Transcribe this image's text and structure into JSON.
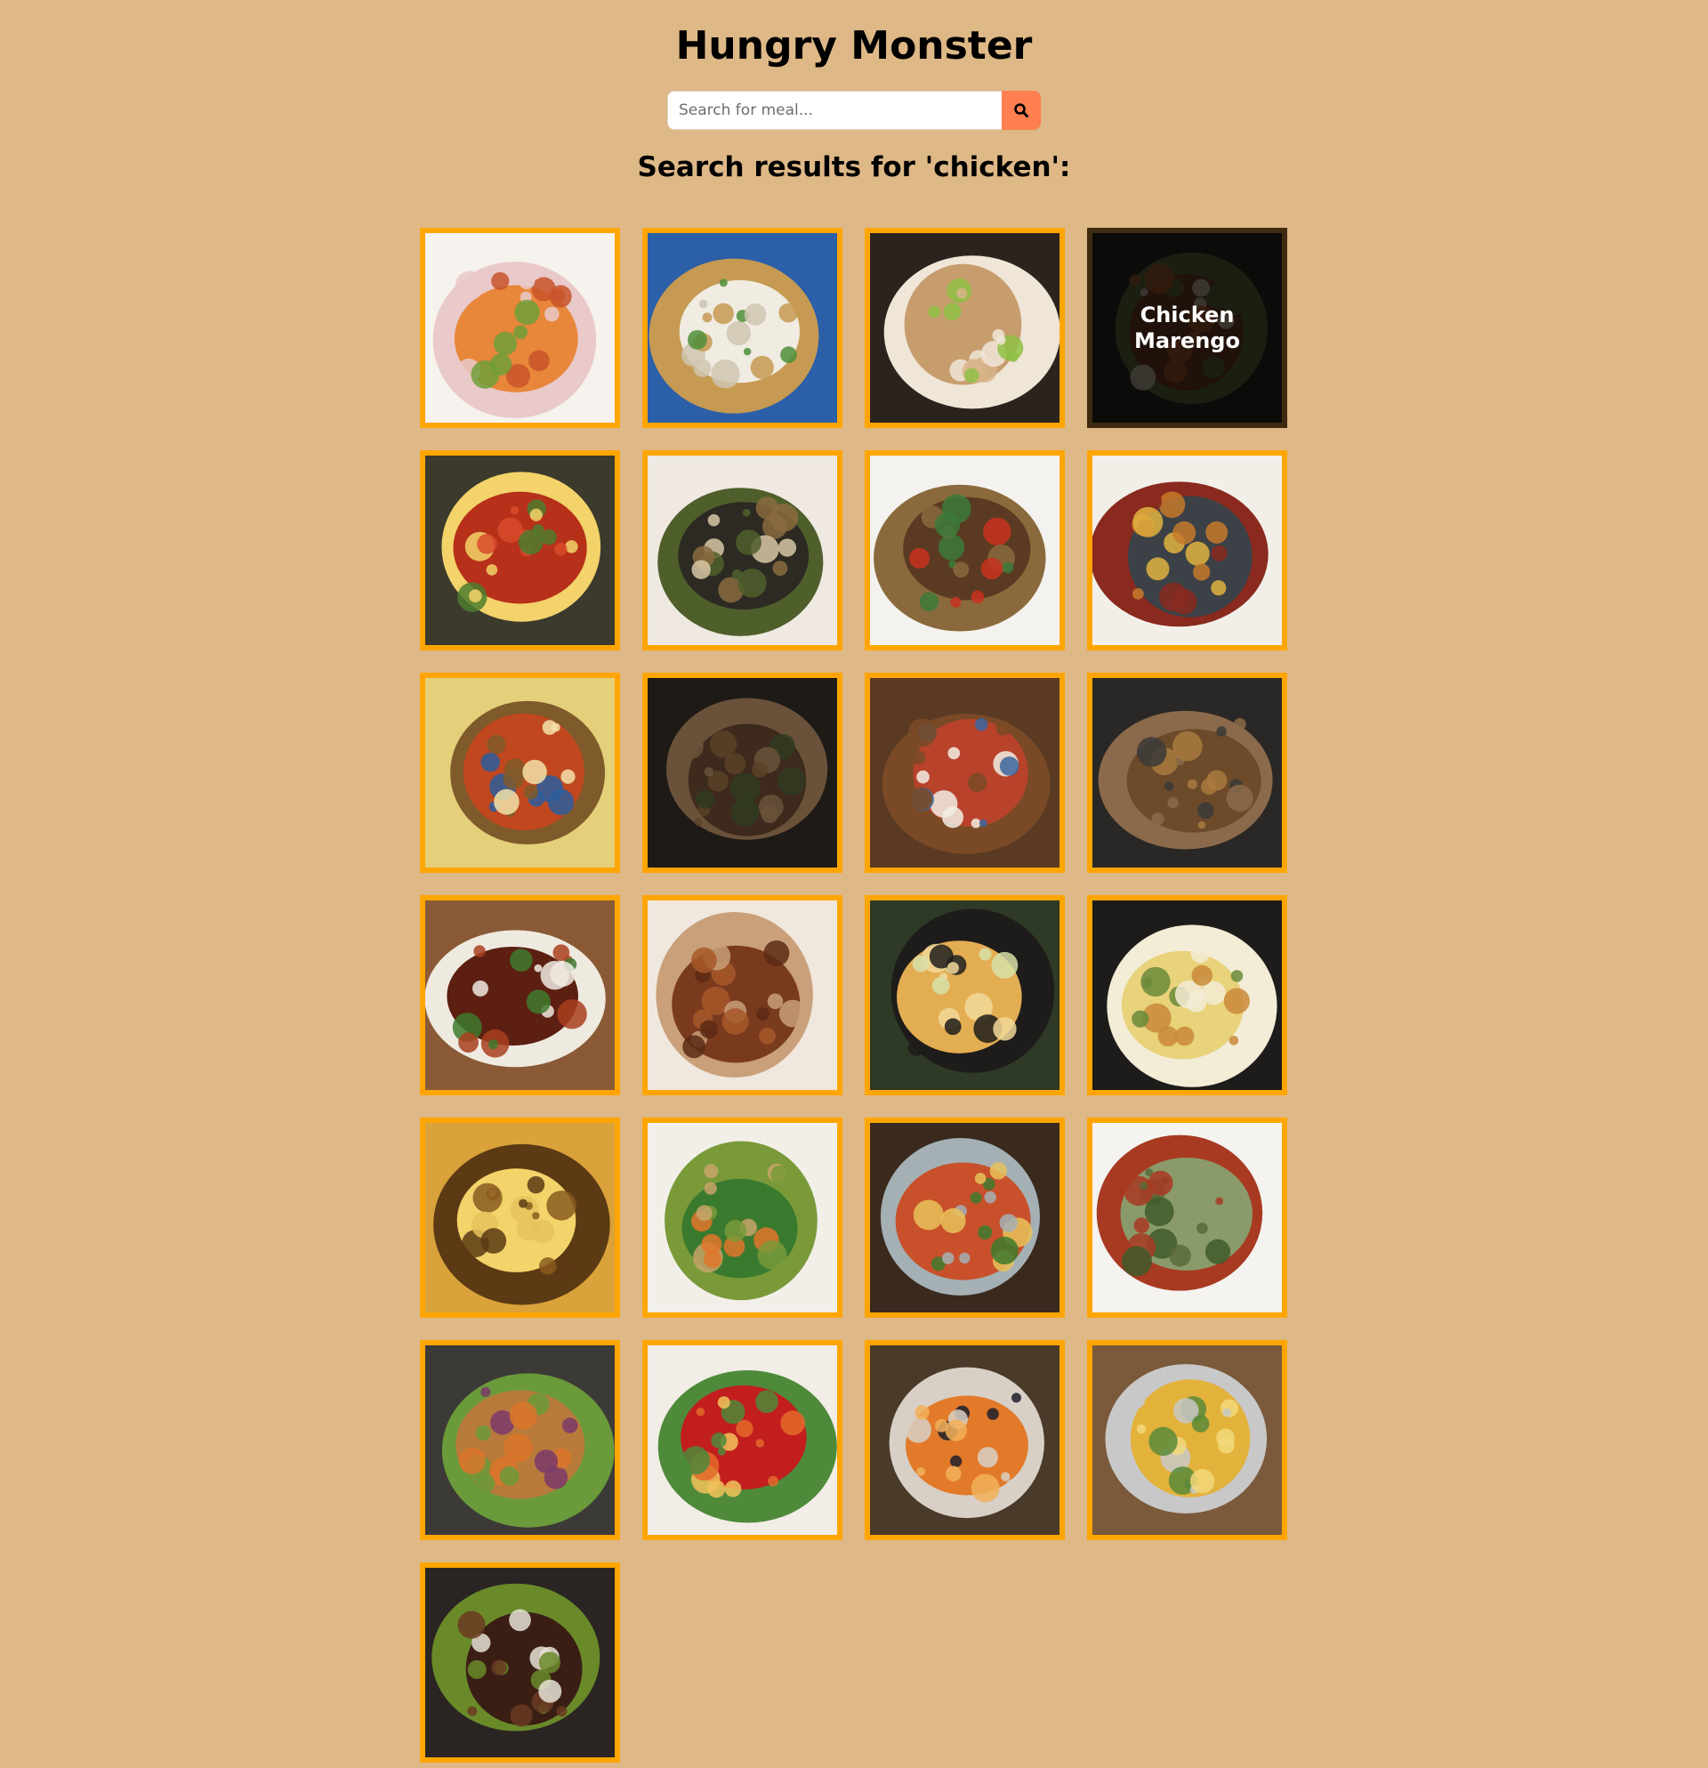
{
  "header": {
    "title": "Hungry Monster"
  },
  "search": {
    "placeholder": "Search for meal...",
    "value": "",
    "button_icon": "search-icon"
  },
  "results": {
    "heading": "Search results for 'chicken':"
  },
  "colors": {
    "background": "#deb887",
    "card_border": "#ffa500",
    "search_button": "#ff7f50"
  },
  "meals": [
    {
      "name": "",
      "photo": "orange chicken curry in floral bowl"
    },
    {
      "name": "",
      "photo": "rice congee in blue patterned bowl"
    },
    {
      "name": "",
      "photo": "chicken on lettuce on cutting board"
    },
    {
      "name": "Chicken Marengo",
      "photo": "chicken stew in dark pot",
      "hovered": true
    },
    {
      "name": "",
      "photo": "red tandoori chicken pieces"
    },
    {
      "name": "",
      "photo": "chicken with grains and herbs in white bowl"
    },
    {
      "name": "",
      "photo": "chicken stir fry with vegetables"
    },
    {
      "name": "",
      "photo": "chicken casserole in grey pan"
    },
    {
      "name": "",
      "photo": "chicken pie with pastry in blue dish"
    },
    {
      "name": "",
      "photo": "dark braised chicken in bowl"
    },
    {
      "name": "",
      "photo": "chicken curry with rice and chopsticks"
    },
    {
      "name": "",
      "photo": "chicken thighs in black skillet"
    },
    {
      "name": "",
      "photo": "glazed chicken over rice in bowl"
    },
    {
      "name": "",
      "photo": "fried chicken pieces on paper"
    },
    {
      "name": "",
      "photo": "chicken pot pie with golden crust"
    },
    {
      "name": "",
      "photo": "chicken pasta in black skillet"
    },
    {
      "name": "",
      "photo": "sliced potato bake with chicken"
    },
    {
      "name": "",
      "photo": "chicken fried rice with broccoli"
    },
    {
      "name": "",
      "photo": "chicken potato gratin in glass dish"
    },
    {
      "name": "",
      "photo": "grilled chicken salad with greens"
    },
    {
      "name": "",
      "photo": "grilled chicken with sweet potato fries"
    },
    {
      "name": "",
      "photo": "chicken enchilada bake in red dish"
    },
    {
      "name": "",
      "photo": "creamy chicken pasta in patterned bowl"
    },
    {
      "name": "",
      "photo": "chicken taco bake in glass dish"
    },
    {
      "name": "",
      "photo": "jerk chicken drumsticks with rice"
    }
  ]
}
